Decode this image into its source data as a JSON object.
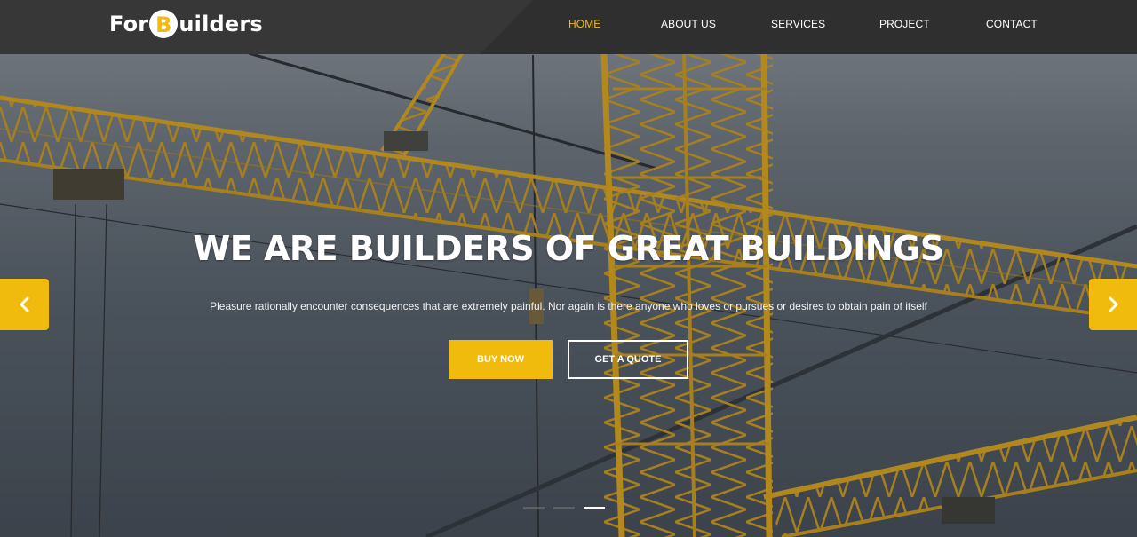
{
  "brand": {
    "logo_prefix": "For",
    "logo_letter": "B",
    "logo_suffix": "uilders",
    "accent_color": "#f1bb0d"
  },
  "nav": {
    "items": [
      {
        "label": "HOME",
        "active": true
      },
      {
        "label": "ABOUT US",
        "active": false
      },
      {
        "label": "SERVICES",
        "active": false
      },
      {
        "label": "PROJECT",
        "active": false
      },
      {
        "label": "CONTACT",
        "active": false
      }
    ]
  },
  "slider": {
    "headline": "WE ARE BUILDERS OF GREAT BUILDINGS",
    "subline": "Pleasure rationally encounter consequences that are extremely painful. Nor again is there anyone who loves or pursues or desires to obtain pain of itself",
    "buy_label": "BUY NOW",
    "quote_label": "GET A QUOTE",
    "prev_icon": "chevron-left-icon",
    "next_icon": "chevron-right-icon",
    "slide_count": 3,
    "active_slide": 3
  }
}
